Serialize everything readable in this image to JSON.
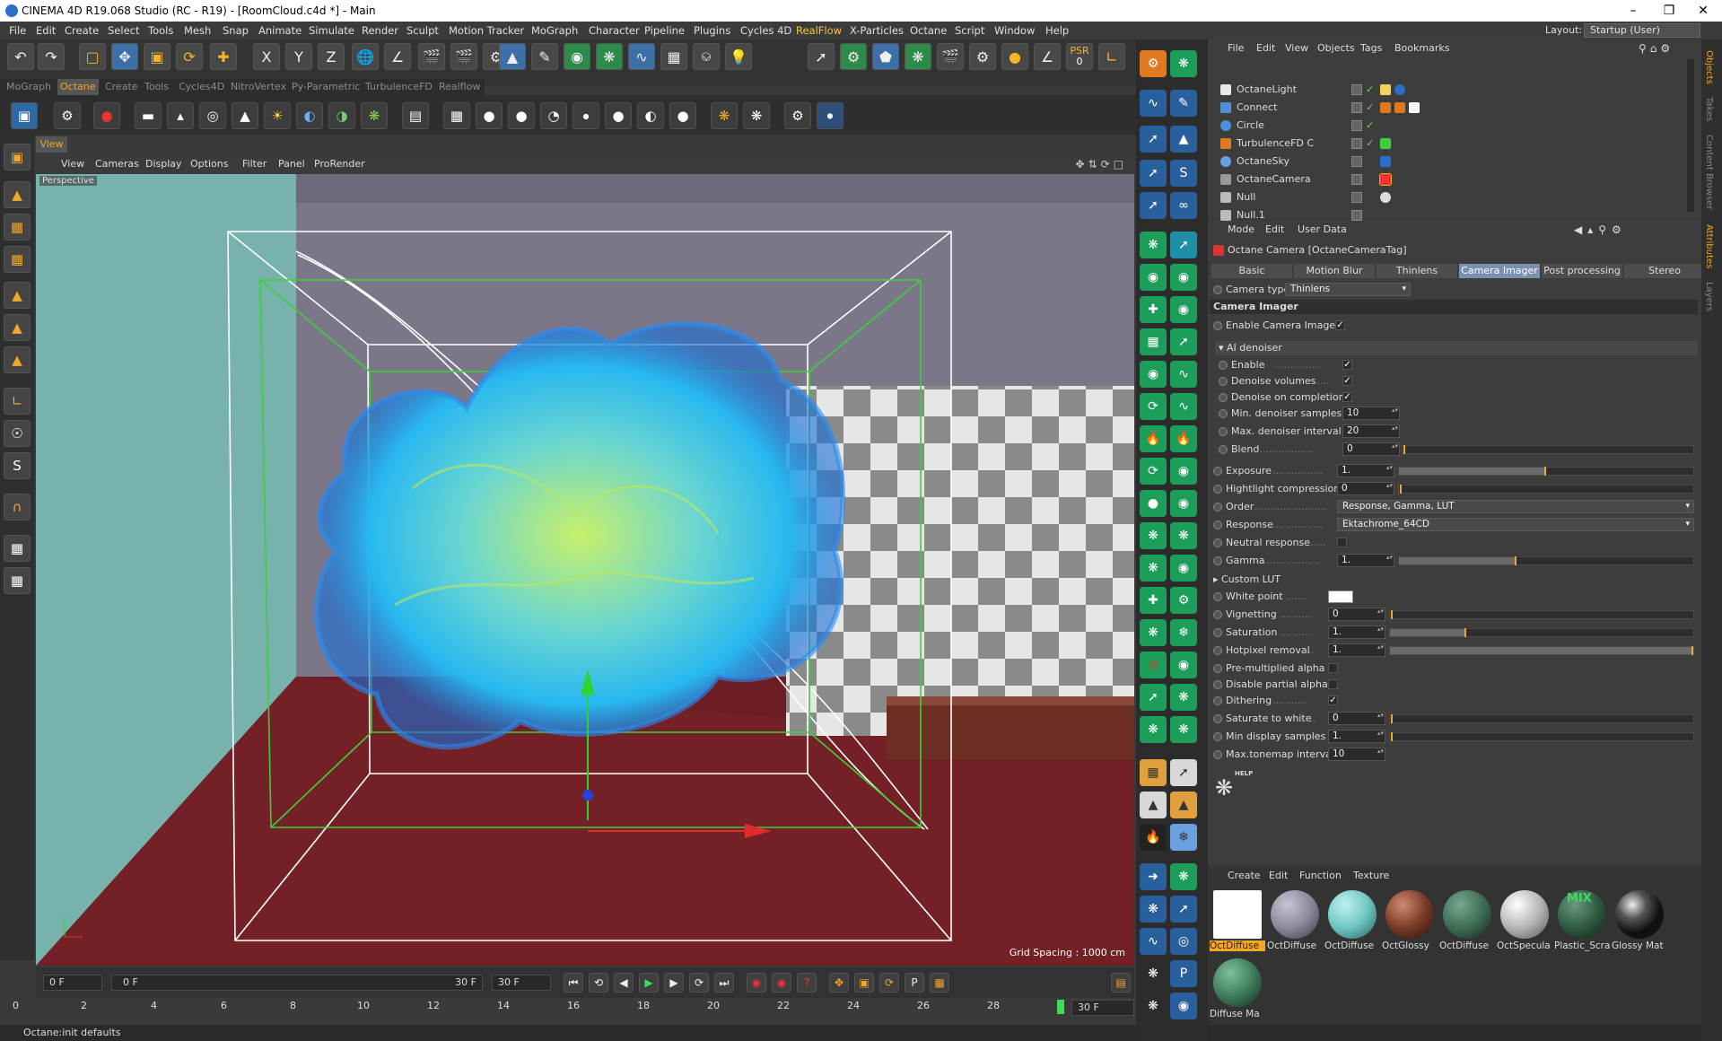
{
  "window": {
    "title": "CINEMA 4D R19.068 Studio (RC - R19) - [RoomCloud.c4d *] - Main",
    "min": "–",
    "max": "❐",
    "close": "✕"
  },
  "menu": [
    "File",
    "Edit",
    "Create",
    "Select",
    "Tools",
    "Mesh",
    "Snap",
    "Animate",
    "Simulate",
    "Render",
    "Sculpt",
    "Motion Tracker",
    "MoGraph",
    "Character",
    "Pipeline",
    "Plugins",
    "Cycles 4D",
    "RealFlow",
    "X-Particles",
    "Octane",
    "Script",
    "Window",
    "Help"
  ],
  "layout": {
    "label": "Layout:",
    "value": "Startup (User)"
  },
  "toolbar": {
    "x": "X",
    "y": "Y",
    "z": "Z",
    "psr": "PSR",
    "psr_val": "0"
  },
  "tabs": [
    "MoGraph",
    "Octane",
    "Create",
    "Tools",
    "Cycles4D",
    "NitroVertex",
    "Py-Parametric",
    "TurbulenceFD",
    "Realflow"
  ],
  "active_tab": "Octane",
  "viewport": {
    "tab": "View",
    "menu": [
      "View",
      "Cameras",
      "Display",
      "Options",
      "Filter",
      "Panel",
      "ProRender"
    ],
    "label": "Perspective",
    "grid": "Grid Spacing : 1000 cm"
  },
  "timeline": {
    "start": "0 F",
    "range_start": "0 F",
    "range_end": "30 F",
    "end": "30 F",
    "current": "30 F"
  },
  "ruler": [
    "0",
    "2",
    "4",
    "6",
    "8",
    "10",
    "12",
    "14",
    "16",
    "18",
    "20",
    "22",
    "24",
    "26",
    "28"
  ],
  "status": "Octane:init defaults",
  "objects": {
    "menu": [
      "File",
      "Edit",
      "View",
      "Objects",
      "Tags",
      "Bookmarks"
    ],
    "rows": [
      {
        "name": "OctaneLight",
        "color": "#e8e8e8"
      },
      {
        "name": "Connect",
        "color": "#4a90d9"
      },
      {
        "name": "Circle",
        "color": "#4a90d9"
      },
      {
        "name": "TurbulenceFD C",
        "color": "#e07a20"
      },
      {
        "name": "OctaneSky",
        "color": "#6aa0e0"
      },
      {
        "name": "OctaneCamera",
        "color": "#999999"
      },
      {
        "name": "Null",
        "color": "#bbbbbb"
      },
      {
        "name": "Null.1",
        "color": "#bbbbbb"
      }
    ]
  },
  "attributes": {
    "menu": [
      "Mode",
      "Edit",
      "User Data"
    ],
    "title": "Octane Camera [OctaneCameraTag]",
    "tabs": [
      "Basic",
      "Motion Blur",
      "Thinlens",
      "Camera Imager",
      "Post processing",
      "Stereo"
    ],
    "active_tab": "Camera Imager",
    "camera_type_label": "Camera type",
    "camera_type": "Thinlens",
    "section": "Camera Imager",
    "enable_imager": "Enable Camera Imager",
    "ai_denoiser": "AI denoiser",
    "enable": "Enable",
    "denoise_volumes": "Denoise volumes",
    "denoise_completion": "Denoise on completion",
    "min_samples_label": "Min. denoiser samples",
    "min_samples": "10",
    "max_interval_label": "Max. denoiser interval",
    "max_interval": "20",
    "blend_label": "Blend",
    "blend": "0",
    "exposure_label": "Exposure",
    "exposure": "1.",
    "highlight_label": "Hightlight compression",
    "highlight": "0",
    "order_label": "Order",
    "order": "Response, Gamma, LUT",
    "response_label": "Response",
    "response": "Ektachrome_64CD",
    "neutral_label": "Neutral response",
    "gamma_label": "Gamma",
    "gamma": "1.",
    "custom_lut": "Custom LUT",
    "white_point": "White point",
    "vignetting_label": "Vignetting",
    "vignetting": "0",
    "saturation_label": "Saturation",
    "saturation": "1.",
    "hotpixel_label": "Hotpixel removal",
    "hotpixel": "1.",
    "premult": "Pre-multiplied alpha",
    "partial": "Disable partial alpha",
    "dithering": "Dithering",
    "sat_white_label": "Saturate to white",
    "sat_white": "0",
    "min_display_label": "Min display samples",
    "min_display": "1.",
    "max_tonemap_label": "Max.tonemap interval",
    "max_tonemap": "10",
    "help": "HELP"
  },
  "levels": {
    "exposure": 0.5,
    "gamma": 0.4,
    "saturation": 0.25,
    "hotpixel": 1.0
  },
  "materials": {
    "menu": [
      "Create",
      "Edit",
      "Function",
      "Texture"
    ],
    "items": [
      {
        "name": "OctDiffuse",
        "color": "#ffffff",
        "selected": true
      },
      {
        "name": "OctDiffuse",
        "color": "#8d8a9c"
      },
      {
        "name": "OctDiffuse",
        "color": "#6fc7c4"
      },
      {
        "name": "OctGlossy",
        "color": "#7a3b28"
      },
      {
        "name": "OctDiffuse",
        "color": "#3e6e56"
      },
      {
        "name": "OctSpecula",
        "color": "#b5b5b5"
      },
      {
        "name": "Plastic_Scra",
        "color": "#2f5a42",
        "tag": "MIX"
      },
      {
        "name": "Glossy Mat",
        "color": "#222222"
      },
      {
        "name": "Diffuse Ma",
        "color": "#3f7d5c"
      }
    ]
  },
  "right_tabs": [
    "Objects",
    "Takes",
    "Content Browser",
    "Attributes",
    "Layers"
  ]
}
